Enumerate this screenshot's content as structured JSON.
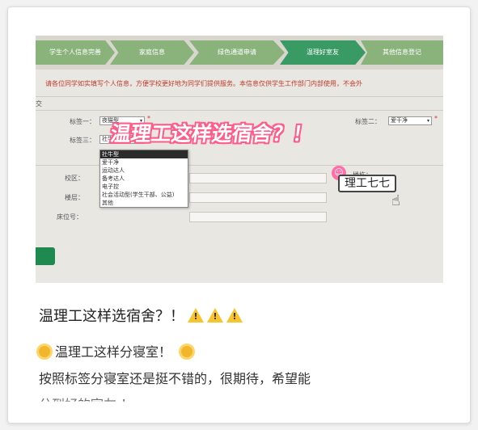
{
  "steps": [
    {
      "label": "学生个人信息完善"
    },
    {
      "label": "家庭信息"
    },
    {
      "label": "绿色通道申请"
    },
    {
      "label": "温理好室友"
    },
    {
      "label": "其他信息登记"
    }
  ],
  "notice": "请各位同学如实填写个人信息，方便学校更好地为同学们提供服务。本信息仅供学生工作部门内部使用，不会外",
  "form": {
    "section_label": "交",
    "tag1_label": "标签一：",
    "tag1_value": "夜猫型",
    "tag2_label": "标签二：",
    "tag2_value": "爱干净",
    "tag3_label": "标签三：",
    "tag3_value": "社牛型",
    "campus_label": "校区：",
    "floor_label": "楼层：",
    "bed_label": "床位号：",
    "building_label": "楼栋："
  },
  "dropdown_options": [
    "社牛型",
    "爱干净",
    "运动达人",
    "备考达人",
    "电子控",
    "社会活动型(学生干部、公益)",
    "其他"
  ],
  "overlay": {
    "title": "温理工这样选宿舍？！",
    "sticker_text": "理工七七"
  },
  "post": {
    "title": "温理工这样选宿舍？！",
    "line1": "温理工这样分寝室！",
    "line2": "按照标签分寝室还是挺不错的，很期待，希望能",
    "line3": "分到好的室友 ！"
  },
  "colors": {
    "step_inactive": "#8ab37c",
    "step_active": "#3a9a64",
    "overlay_stroke": "#ff5c8a",
    "warn_yellow": "#f7c52b",
    "notice_red": "#c03a2b"
  }
}
